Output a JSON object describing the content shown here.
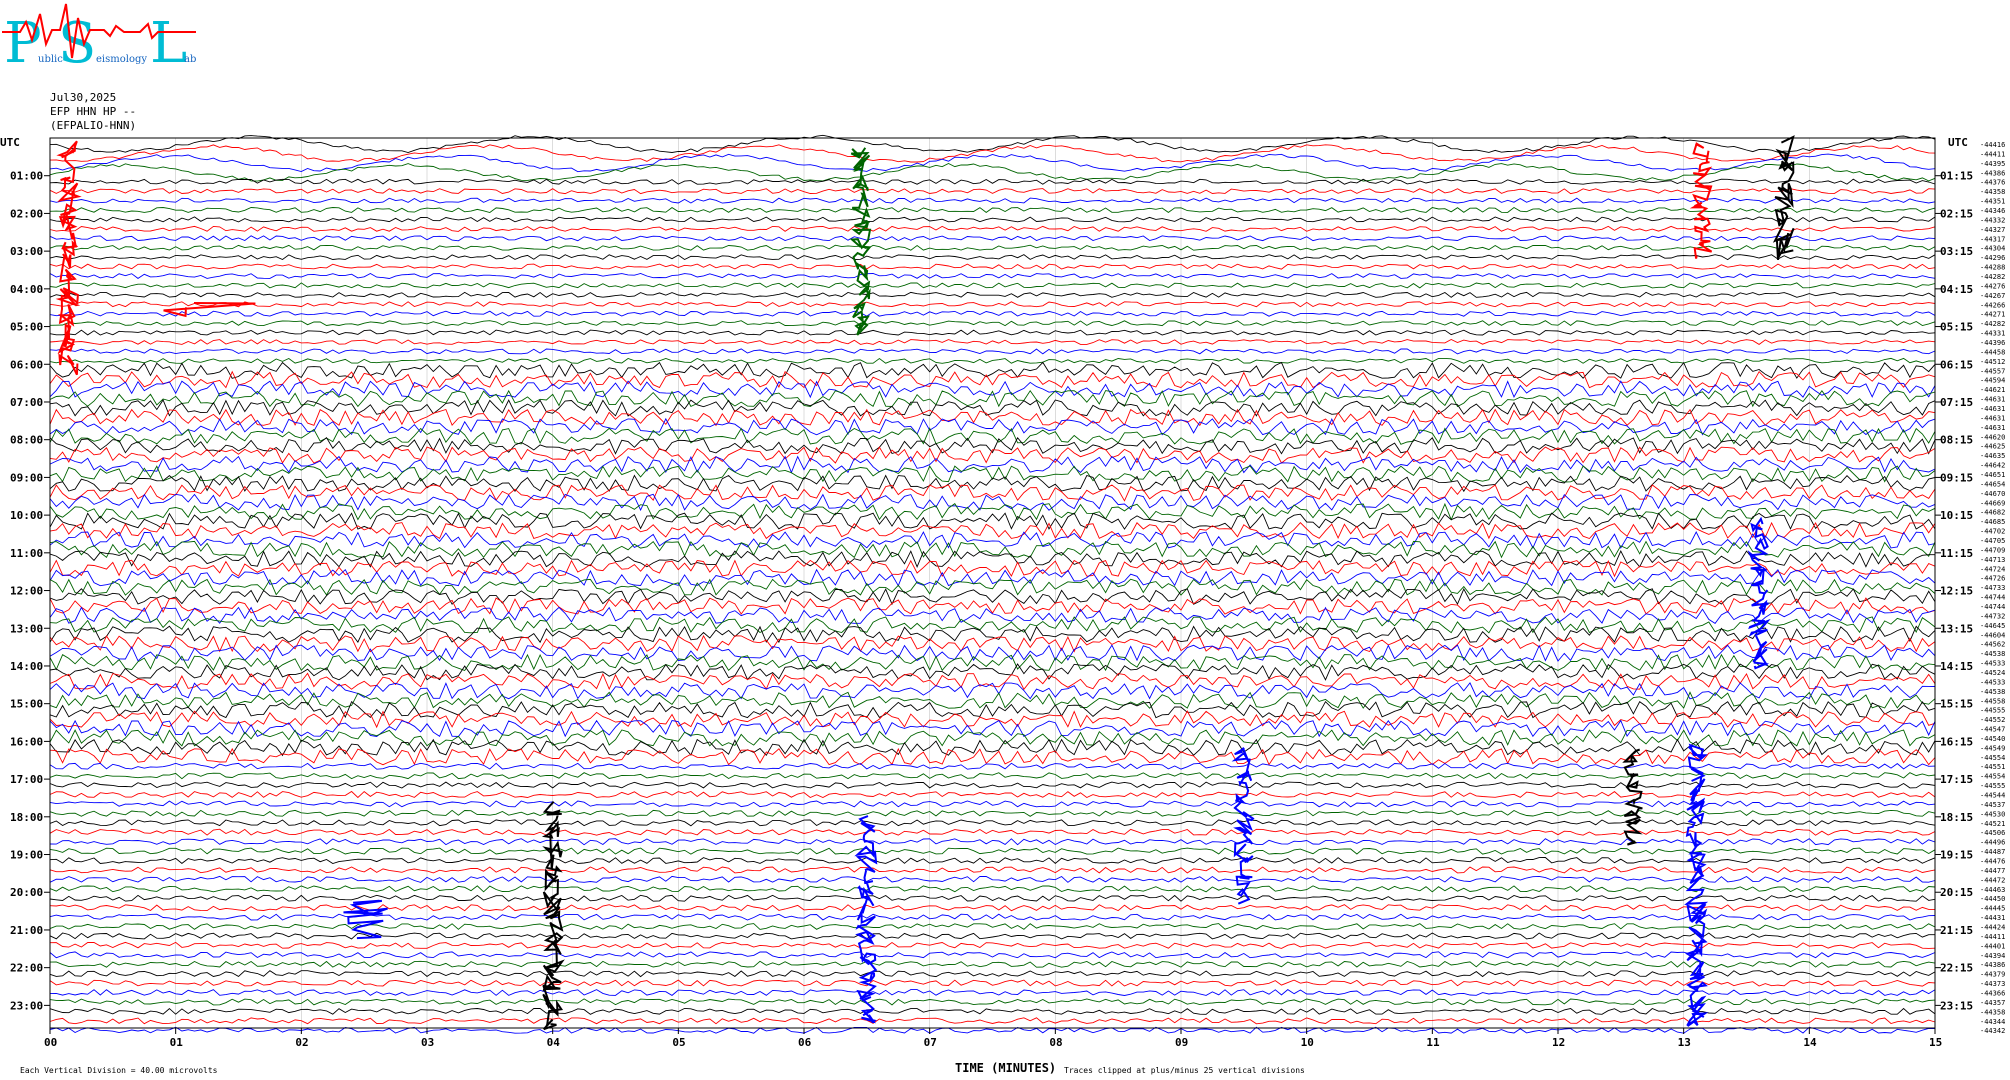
{
  "logo": {
    "letters": [
      "P",
      "S",
      "L"
    ],
    "small_text": [
      "ublic",
      "eismology",
      "ab"
    ]
  },
  "header": {
    "date": "Jul30,2025",
    "channel": "EFP HHN HP --",
    "station": "(EFPALIO-HNN)"
  },
  "labels": {
    "utc_left": "UTC",
    "utc_right": "UTC",
    "xlabel": "TIME (MINUTES)",
    "vertical_division": "Each Vertical Division =   40.00 microvolts",
    "clip_note": "Traces clipped at plus/minus 25 vertical divisions"
  },
  "colors": {
    "trace_colors": [
      "#000000",
      "#ff0000",
      "#0000ff",
      "#006400"
    ]
  },
  "chart_data": {
    "type": "line",
    "xlim": [
      0,
      15
    ],
    "x_ticks": [
      "00",
      "01",
      "02",
      "03",
      "04",
      "05",
      "06",
      "07",
      "08",
      "09",
      "10",
      "11",
      "12",
      "13",
      "14",
      "15"
    ],
    "left_time_labels": [
      "01:00",
      "02:00",
      "03:00",
      "04:00",
      "05:00",
      "06:00",
      "07:00",
      "08:00",
      "09:00",
      "10:00",
      "11:00",
      "12:00",
      "13:00",
      "14:00",
      "15:00",
      "16:00",
      "17:00",
      "18:00",
      "19:00",
      "20:00",
      "21:00",
      "22:00",
      "23:00"
    ],
    "right_time_labels": [
      "01:15",
      "02:15",
      "03:15",
      "04:15",
      "05:15",
      "06:15",
      "07:15",
      "08:15",
      "09:15",
      "10:15",
      "11:15",
      "12:15",
      "13:15",
      "14:15",
      "15:15",
      "16:15",
      "17:15",
      "18:15",
      "19:15",
      "20:15",
      "21:15",
      "22:15",
      "23:15"
    ],
    "trace_offsets": [
      -44416,
      -44411,
      -44395,
      -44386,
      -44376,
      -44358,
      -44351,
      -44346,
      -44332,
      -44327,
      -44317,
      -44304,
      -44296,
      -44288,
      -44282,
      -44276,
      -44267,
      -44266,
      -44271,
      -44282,
      -44331,
      -44396,
      -44458,
      -44512,
      -44557,
      -44594,
      -44621,
      -44631,
      -44631,
      -44631,
      -44631,
      -44620,
      -44625,
      -44635,
      -44642,
      -44651,
      -44654,
      -44670,
      -44669,
      -44682,
      -44685,
      -44702,
      -44705,
      -44709,
      -44713,
      -44724,
      -44726,
      -44733,
      -44744,
      -44744,
      -44732,
      -44645,
      -44604,
      -44562,
      -44538,
      -44533,
      -44524,
      -44533,
      -44538,
      -44558,
      -44555,
      -44552,
      -44547,
      -44540,
      -44549,
      -44554,
      -44551,
      -44554,
      -44555,
      -44544,
      -44537,
      -44530,
      -44521,
      -44506,
      -44496,
      -44487,
      -44476,
      -44477,
      -44472,
      -44463,
      -44450,
      -44445,
      -44431,
      -44424,
      -44411,
      -44401,
      -44394,
      -44386,
      -44379,
      -44373,
      -44366,
      -44357,
      -44358,
      -44344,
      -44342
    ]
  }
}
